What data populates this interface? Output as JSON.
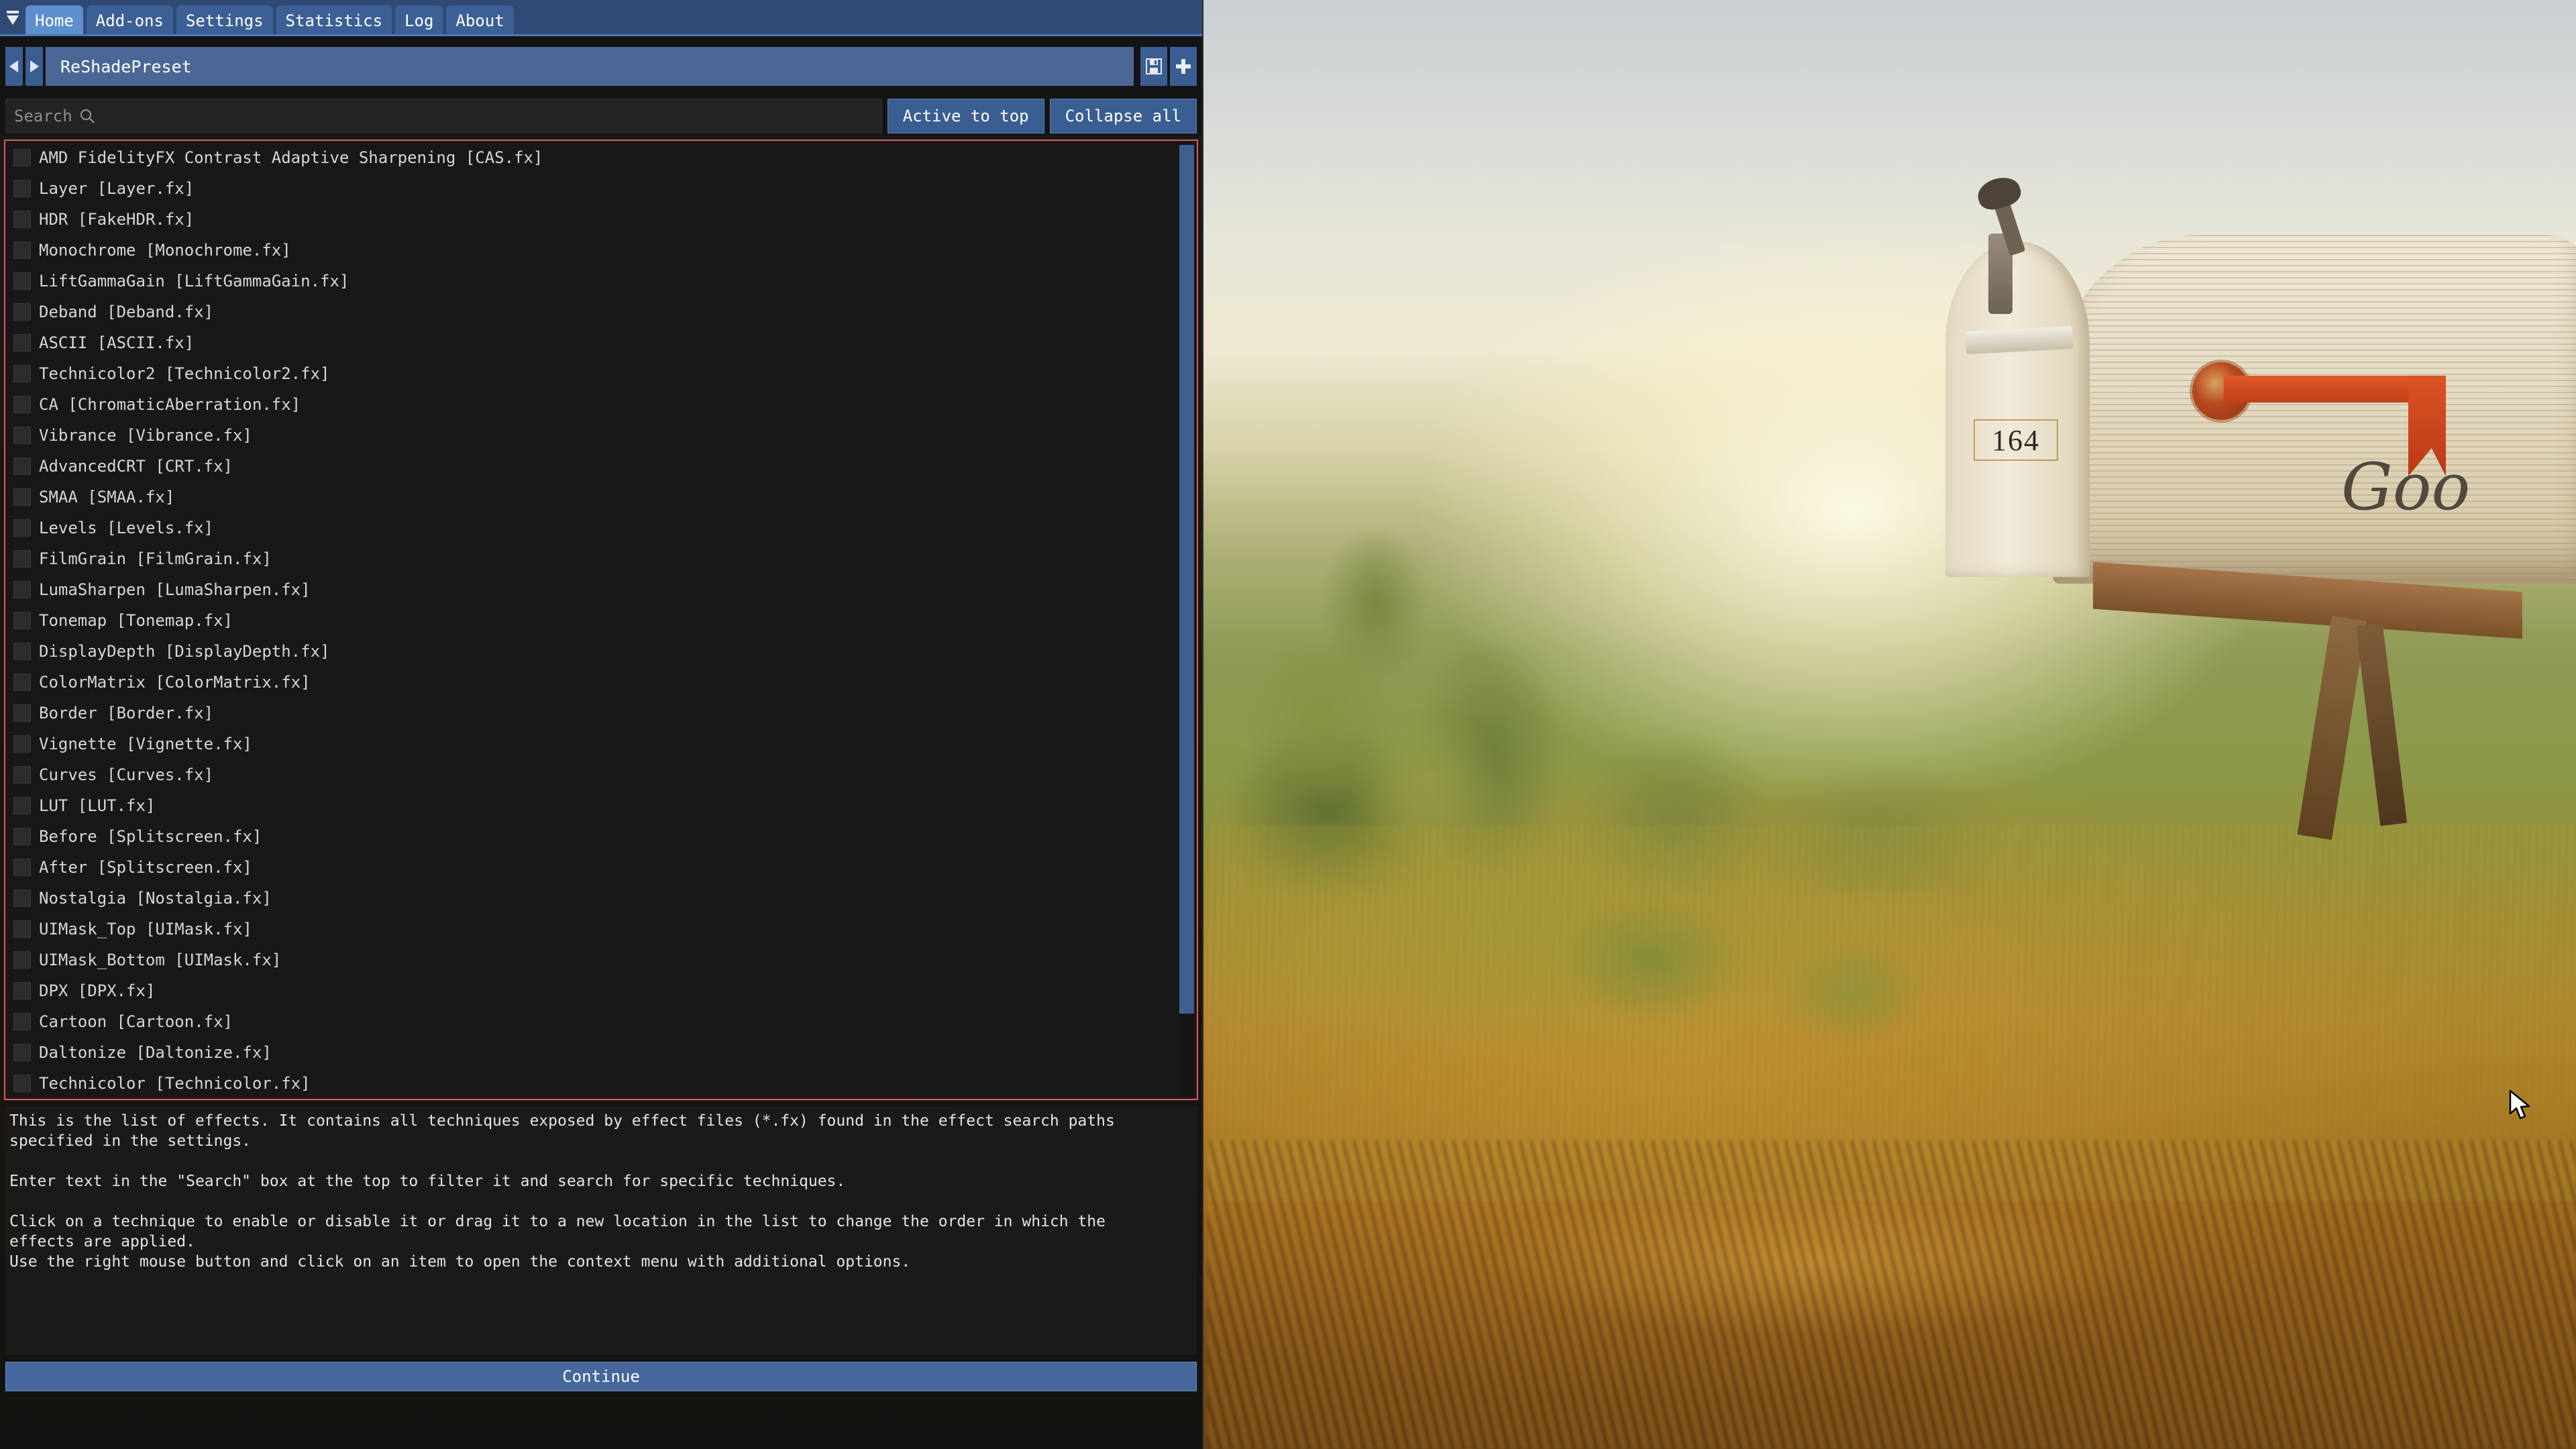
{
  "window": {
    "collapse_arrow_icon": "collapse-down-icon",
    "tabs": [
      {
        "label": "Home",
        "active": true
      },
      {
        "label": "Add-ons",
        "active": false
      },
      {
        "label": "Settings",
        "active": false
      },
      {
        "label": "Statistics",
        "active": false
      },
      {
        "label": "Log",
        "active": false
      },
      {
        "label": "About",
        "active": false
      }
    ]
  },
  "preset": {
    "prev_icon": "triangle-left-icon",
    "next_icon": "triangle-right-icon",
    "value": "ReShadePreset",
    "save_icon": "floppy-save-icon",
    "add_icon": "plus-icon"
  },
  "search": {
    "placeholder": "Search",
    "icon": "magnifier-icon",
    "value": ""
  },
  "toolbar": {
    "active_to_top_label": "Active to top",
    "collapse_all_label": "Collapse all"
  },
  "effects": {
    "border_color": "#e05a5a",
    "items": [
      {
        "label": "AMD FidelityFX Contrast Adaptive Sharpening [CAS.fx]",
        "enabled": false
      },
      {
        "label": "Layer [Layer.fx]",
        "enabled": false
      },
      {
        "label": "HDR [FakeHDR.fx]",
        "enabled": false
      },
      {
        "label": "Monochrome [Monochrome.fx]",
        "enabled": false
      },
      {
        "label": "LiftGammaGain [LiftGammaGain.fx]",
        "enabled": false
      },
      {
        "label": "Deband [Deband.fx]",
        "enabled": false
      },
      {
        "label": "ASCII [ASCII.fx]",
        "enabled": false
      },
      {
        "label": "Technicolor2 [Technicolor2.fx]",
        "enabled": false
      },
      {
        "label": "CA [ChromaticAberration.fx]",
        "enabled": false
      },
      {
        "label": "Vibrance [Vibrance.fx]",
        "enabled": false
      },
      {
        "label": "AdvancedCRT [CRT.fx]",
        "enabled": false
      },
      {
        "label": "SMAA [SMAA.fx]",
        "enabled": false
      },
      {
        "label": "Levels [Levels.fx]",
        "enabled": false
      },
      {
        "label": "FilmGrain [FilmGrain.fx]",
        "enabled": false
      },
      {
        "label": "LumaSharpen [LumaSharpen.fx]",
        "enabled": false
      },
      {
        "label": "Tonemap [Tonemap.fx]",
        "enabled": false
      },
      {
        "label": "DisplayDepth [DisplayDepth.fx]",
        "enabled": false
      },
      {
        "label": "ColorMatrix [ColorMatrix.fx]",
        "enabled": false
      },
      {
        "label": "Border [Border.fx]",
        "enabled": false
      },
      {
        "label": "Vignette [Vignette.fx]",
        "enabled": false
      },
      {
        "label": "Curves [Curves.fx]",
        "enabled": false
      },
      {
        "label": "LUT [LUT.fx]",
        "enabled": false
      },
      {
        "label": "Before [Splitscreen.fx]",
        "enabled": false
      },
      {
        "label": "After [Splitscreen.fx]",
        "enabled": false
      },
      {
        "label": "Nostalgia [Nostalgia.fx]",
        "enabled": false
      },
      {
        "label": "UIMask_Top [UIMask.fx]",
        "enabled": false
      },
      {
        "label": "UIMask_Bottom [UIMask.fx]",
        "enabled": false
      },
      {
        "label": "DPX [DPX.fx]",
        "enabled": false
      },
      {
        "label": "Cartoon [Cartoon.fx]",
        "enabled": false
      },
      {
        "label": "Daltonize [Daltonize.fx]",
        "enabled": false
      },
      {
        "label": "Technicolor [Technicolor.fx]",
        "enabled": false
      }
    ]
  },
  "help": {
    "paragraph_1": "This is the list of effects. It contains all techniques exposed by effect files (*.fx) found in the effect search paths\nspecified in the settings.",
    "paragraph_2": "Enter text in the \"Search\" box at the top to filter it and search for specific techniques.",
    "paragraph_3": "Click on a technique to enable or disable it or drag it to a new location in the list to change the order in which the\neffects are applied.\nUse the right mouse button and click on an item to open the context menu with additional options."
  },
  "footer": {
    "continue_label": "Continue"
  },
  "game_scene": {
    "mailbox_number": "164",
    "mailbox_script_text": "Goo"
  }
}
